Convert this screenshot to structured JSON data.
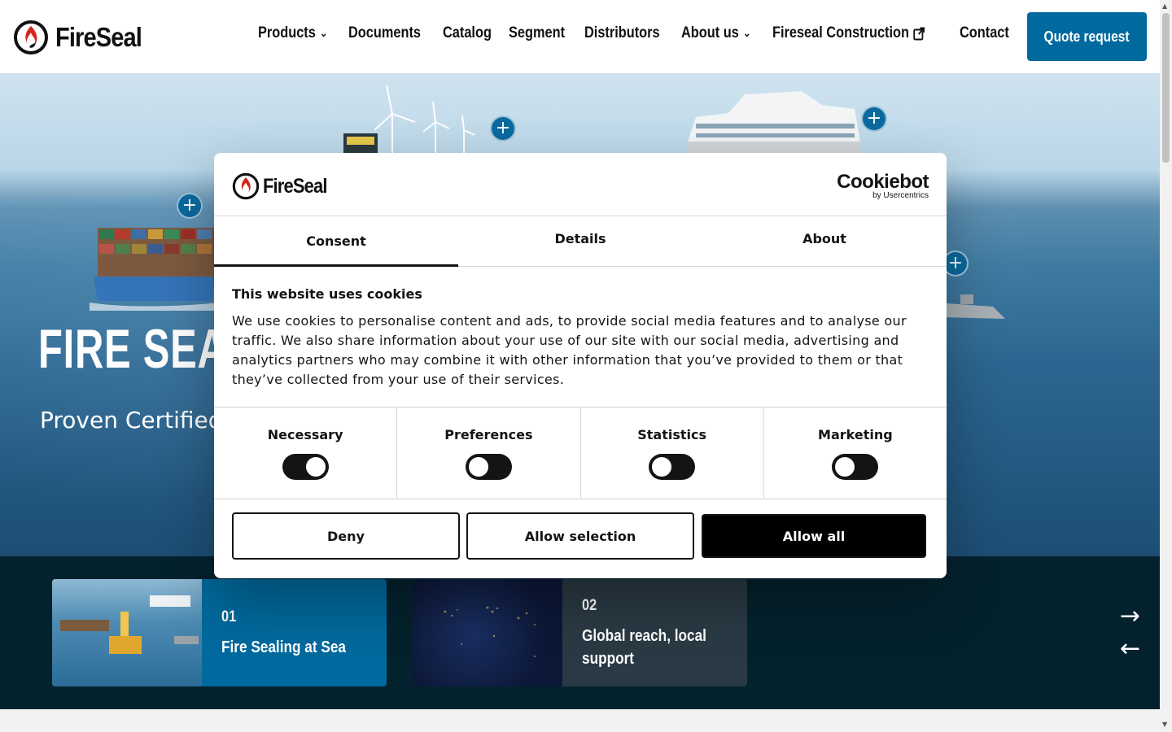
{
  "header": {
    "logo_text": "FireSeal",
    "nav": [
      {
        "label": "Products",
        "has_dropdown": true
      },
      {
        "label": "Documents",
        "has_dropdown": false
      },
      {
        "label": "Catalog",
        "has_dropdown": false
      },
      {
        "label": "Segment",
        "has_dropdown": false
      },
      {
        "label": "Distributors",
        "has_dropdown": false
      },
      {
        "label": "About us",
        "has_dropdown": true
      },
      {
        "label": "Fireseal Construction",
        "external": true
      },
      {
        "label": "Contact",
        "has_dropdown": false
      }
    ],
    "quote_button": "Quote request",
    "accent_color": "#006a9e"
  },
  "hero": {
    "title": "FIRE SEAL",
    "subtitle": "Proven Certified"
  },
  "cards": [
    {
      "number": "01",
      "title": "Fire Sealing at Sea",
      "bg": "#006a9e"
    },
    {
      "number": "02",
      "title": "Global reach, local support",
      "bg": "#2a3a44"
    }
  ],
  "cookie_dialog": {
    "logo_text": "FireSeal",
    "provider": "Cookiebot",
    "provider_sub": "by Usercentrics",
    "tabs": [
      {
        "label": "Consent",
        "active": true
      },
      {
        "label": "Details",
        "active": false
      },
      {
        "label": "About",
        "active": false
      }
    ],
    "heading": "This website uses cookies",
    "body": "We use cookies to personalise content and ads, to provide social media features and to analyse our traffic. We also share information about your use of our site with our social media, advertising and analytics partners who may combine it with other information that you’ve provided to them or that they’ve collected from your use of their services.",
    "toggles": [
      {
        "label": "Necessary",
        "on": true
      },
      {
        "label": "Preferences",
        "on": false
      },
      {
        "label": "Statistics",
        "on": false
      },
      {
        "label": "Marketing",
        "on": false
      }
    ],
    "buttons": {
      "deny": "Deny",
      "allow_selection": "Allow selection",
      "allow_all": "Allow all"
    }
  },
  "icons": {
    "chevron": "chevron-down-icon",
    "external": "external-link-icon",
    "plus": "plus-icon",
    "arrow_right": "arrow-right-icon",
    "arrow_left": "arrow-left-icon"
  }
}
